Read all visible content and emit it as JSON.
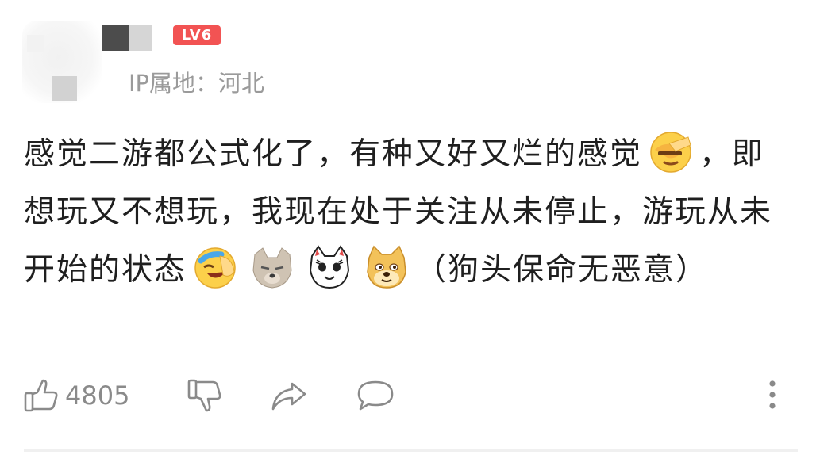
{
  "user": {
    "level_badge": "LV6",
    "ip_location": "IP属地：河北"
  },
  "comment": {
    "text_1": "感觉二游都公式化了，有种又好又烂的感觉",
    "emoji_1": "facepalm-emoji",
    "text_2": "，即想玩又不想玩，我现在处于关注从未停止，游玩从未开始的状态",
    "emoji_2": "laugh-cry-emoji",
    "emoji_3": "wolf-emoji",
    "emoji_4": "cat-emoji",
    "emoji_5": "doge-emoji",
    "text_3": "（狗头保命无恶意）"
  },
  "actions": {
    "like_count": "4805",
    "icons": [
      "thumbs-up-icon",
      "thumbs-down-icon",
      "share-icon",
      "comment-icon",
      "more-icon"
    ]
  },
  "colors": {
    "badge": "#f25353",
    "muted_text": "#9a9a9a",
    "icon": "#8a8a8a"
  }
}
